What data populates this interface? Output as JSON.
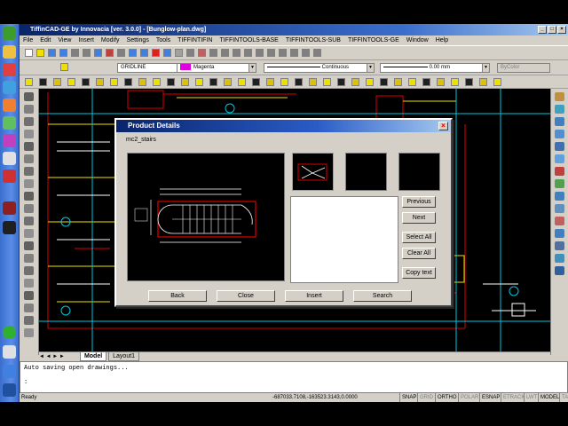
{
  "window": {
    "title": "TiffinCAD-GE  by Innovacia [ver. 3.0.0]  - [Bunglow-plan.dwg]"
  },
  "menu": [
    "File",
    "Edit",
    "View",
    "Insert",
    "Modify",
    "Settings",
    "Tools",
    "TIFFINTIFIN",
    "TIFFINTOOLS-BASE",
    "TIFFINTOOLS-SUB",
    "TIFFINTOOLS-GE",
    "Window",
    "Help"
  ],
  "properties": {
    "layer": "GRIDLINE",
    "color": "Magenta",
    "linetype": "Continuous",
    "lineweight": "0.00 mm",
    "plot_style": "ByColor"
  },
  "layout_tabs": [
    "Model",
    "Layout1"
  ],
  "command": {
    "line1": "Auto saving open drawings...",
    "line2": ":"
  },
  "status": {
    "ready": "Ready",
    "coords": "-687033.7108,-163523.3143,0.0000",
    "toggles": [
      "SNAP",
      "GRID",
      "ORTHO",
      "POLAR",
      "ESNAP",
      "ETRACK",
      "LWT",
      "MODEL",
      "TABLET"
    ]
  },
  "dialog": {
    "title": "Product Details",
    "subtitle": "mc2_stairs",
    "buttons": {
      "previous": "Previous",
      "next": "Next",
      "select_all": "Select All",
      "clear_all": "Clear All",
      "copy_text": "Copy text"
    },
    "footer": {
      "back": "Back",
      "close": "Close",
      "insert": "Insert",
      "search": "Search"
    }
  },
  "colors": {
    "accent": "#0a246a",
    "cad_bg": "#000000",
    "cad_red": "#e00000",
    "cad_yellow": "#f0e000",
    "cad_cyan": "#00c8e0",
    "cad_magenta": "#e000e0"
  }
}
